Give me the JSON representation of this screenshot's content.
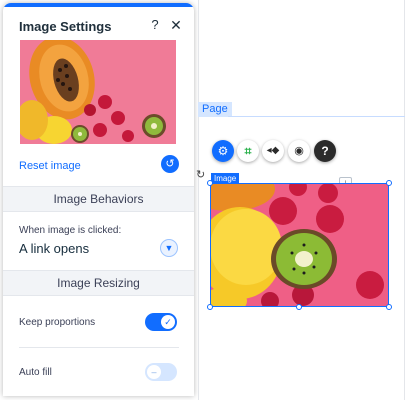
{
  "panel": {
    "title": "Image Settings",
    "help_glyph": "?",
    "close_glyph": "✕",
    "accent_color": "#116dff",
    "reset_label": "Reset image",
    "reset_icon": "undo-icon",
    "sections": {
      "behaviors": "Image Behaviors",
      "resizing": "Image Resizing"
    },
    "click_behavior": {
      "label": "When image is clicked:",
      "value": "A link opens"
    },
    "keep_proportions": {
      "label": "Keep proportions",
      "enabled": true
    },
    "auto_fill": {
      "label": "Auto fill",
      "enabled": false
    }
  },
  "canvas": {
    "page_label": "Page",
    "image_label": "Image",
    "toolbar_icons": [
      "settings-gear-icon",
      "crop-icon",
      "animation-icon",
      "hide-icon",
      "help-icon"
    ]
  }
}
